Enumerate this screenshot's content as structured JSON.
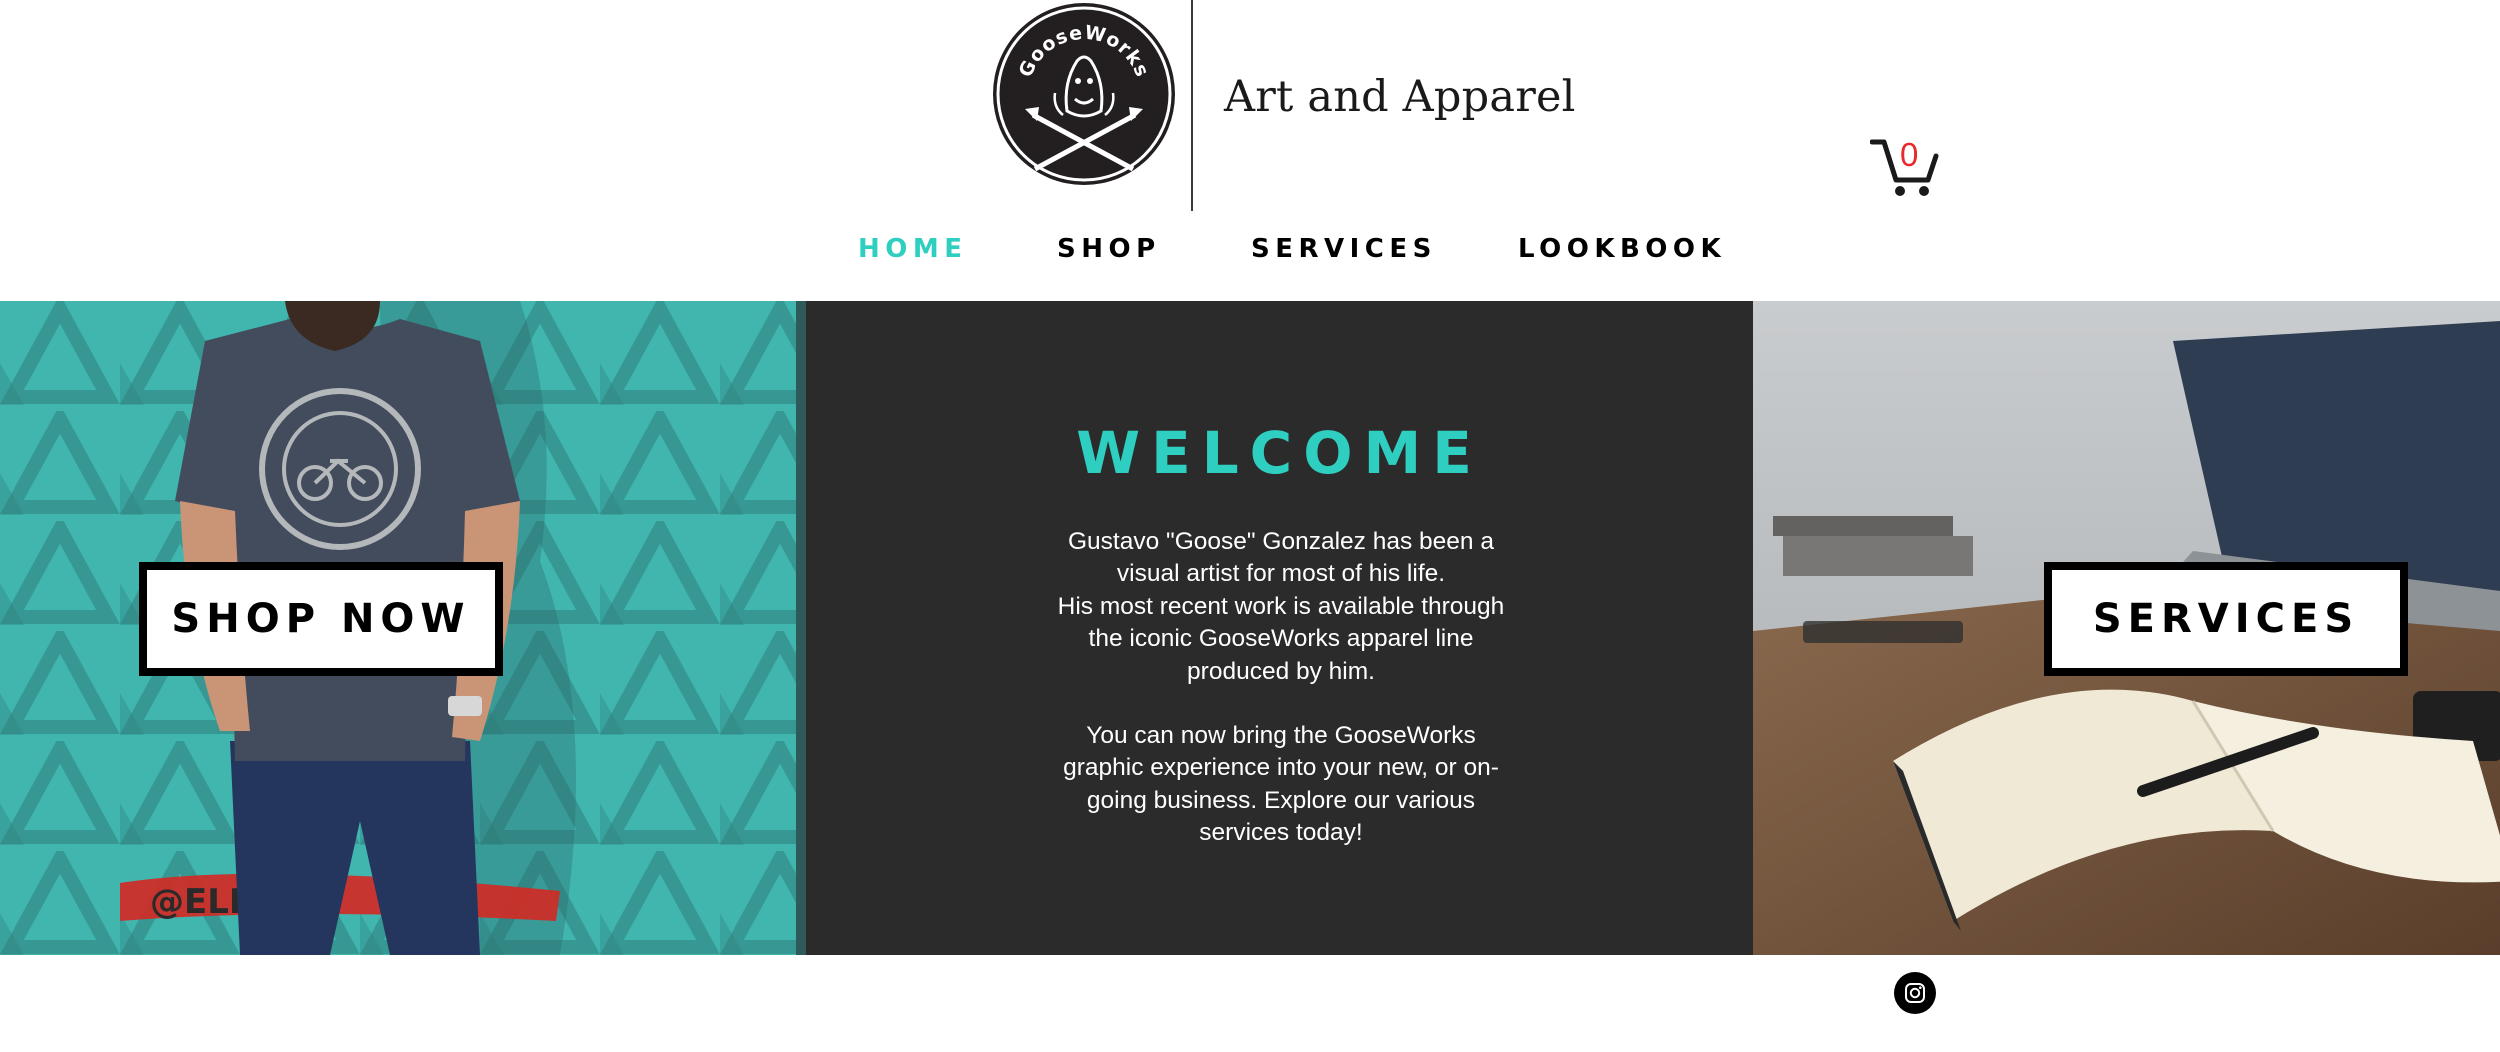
{
  "header": {
    "logo_text": "GooseWorks",
    "tagline": "Art and Apparel",
    "cart_count": "0",
    "cart_icon": "shopping-cart-icon"
  },
  "nav": {
    "items": [
      {
        "label": "HOME",
        "active": true
      },
      {
        "label": "SHOP",
        "active": false
      },
      {
        "label": "SERVICES",
        "active": false
      },
      {
        "label": "LOOKBOOK",
        "active": false
      }
    ]
  },
  "left_panel": {
    "button_label": "SHOP NOW",
    "graffiti_text": "@ELN"
  },
  "center_panel": {
    "title": "WELCOME",
    "paragraph1": [
      "Gustavo \"Goose\" Gonzalez has been a",
      "visual artist for most of his life.",
      "His most recent work is available through",
      "the iconic GooseWorks apparel line",
      "produced by him."
    ],
    "paragraph2": [
      "You can now bring the GooseWorks",
      "graphic experience into your new, or on-",
      "going business. Explore our various",
      "services today!"
    ]
  },
  "right_panel": {
    "button_label": "SERVICES"
  },
  "footer": {
    "social_icon": "instagram-icon"
  },
  "colors": {
    "accent": "#2ecfc0",
    "cart_count": "#e8282b",
    "dark_panel": "#2b2b2b",
    "teal_wall": "#3fb3ad"
  }
}
